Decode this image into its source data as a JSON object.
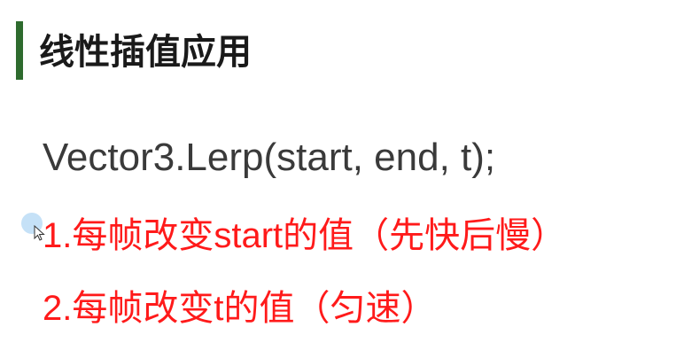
{
  "slide": {
    "title": "线性插值应用",
    "code": "Vector3.Lerp(start, end, t);",
    "points": [
      "1.每帧改变start的值（先快后慢）",
      "2.每帧改变t的值（匀速）"
    ]
  },
  "colors": {
    "accent_bar": "#2e6b2e",
    "title_text": "#1a1a1a",
    "code_text": "#3a3a3a",
    "point_text": "#ff1a1a"
  },
  "icons": {
    "cursor": "mouse-pointer-icon"
  }
}
